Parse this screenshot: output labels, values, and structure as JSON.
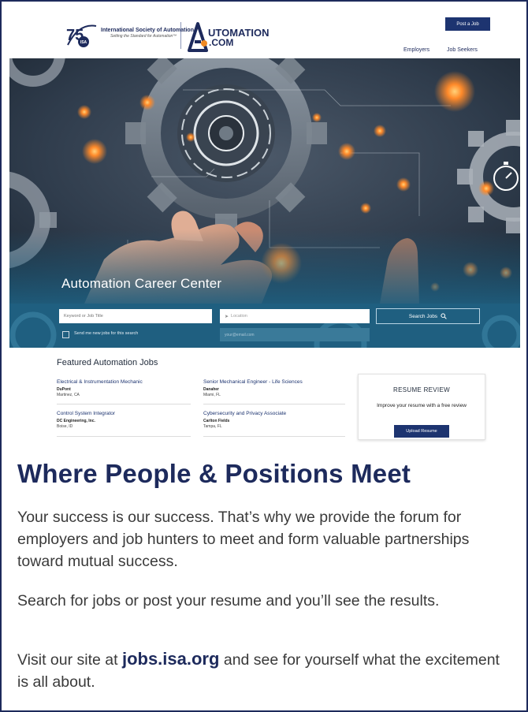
{
  "header": {
    "isa_logo_number": "75",
    "isa_logo_abbr": "ISA",
    "isa_name": "International Society of Automation",
    "isa_tagline": "Setting the Standard for Automation™",
    "automation_logo_top": "UTOMATION",
    "automation_logo_bottom": ".COM",
    "post_job_label": "Post a Job",
    "nav": {
      "employers": "Employers",
      "job_seekers": "Job Seekers"
    }
  },
  "hero": {
    "title": "Automation Career Center"
  },
  "search": {
    "keyword_placeholder": "Keyword or Job Title",
    "location_placeholder": "Location",
    "search_button": "Search Jobs",
    "alert_label": "Send me new jobs for this search",
    "email_placeholder": "your@email.com"
  },
  "featured": {
    "title": "Featured Automation Jobs",
    "jobs": [
      {
        "title": "Electrical & Instrumentation Mechanic",
        "company": "DuPont",
        "location": "Martinez, CA"
      },
      {
        "title": "Senior Mechanical Engineer - Life Sciences",
        "company": "Danaher",
        "location": "Miami, FL"
      },
      {
        "title": "Control System Integrator",
        "company": "DC Engineering, Inc.",
        "location": "Boise, ID"
      },
      {
        "title": "Cybersecurity and Privacy Associate",
        "company": "Carlton Fields",
        "location": "Tampa, FL"
      }
    ]
  },
  "resume_review": {
    "title": "RESUME REVIEW",
    "text": "Improve your resume with a free review",
    "button": "Upload Resume"
  },
  "copy": {
    "headline": "Where People & Positions Meet",
    "para1": "Your success is our success. That’s why we provide the forum for employers and job hunters to meet and form valuable partnerships toward mutual success.",
    "para2": "Search for jobs or post your resume and you’ll see the results.",
    "para3_prefix": "Visit our site at ",
    "para3_link": "jobs.isa.org",
    "para3_suffix": " and see for yourself what the excitement is all about."
  },
  "colors": {
    "navy": "#1d2a5c",
    "button_blue": "#1d3470",
    "search_band": "#1f5f80",
    "glow": "#ff8a2a"
  }
}
